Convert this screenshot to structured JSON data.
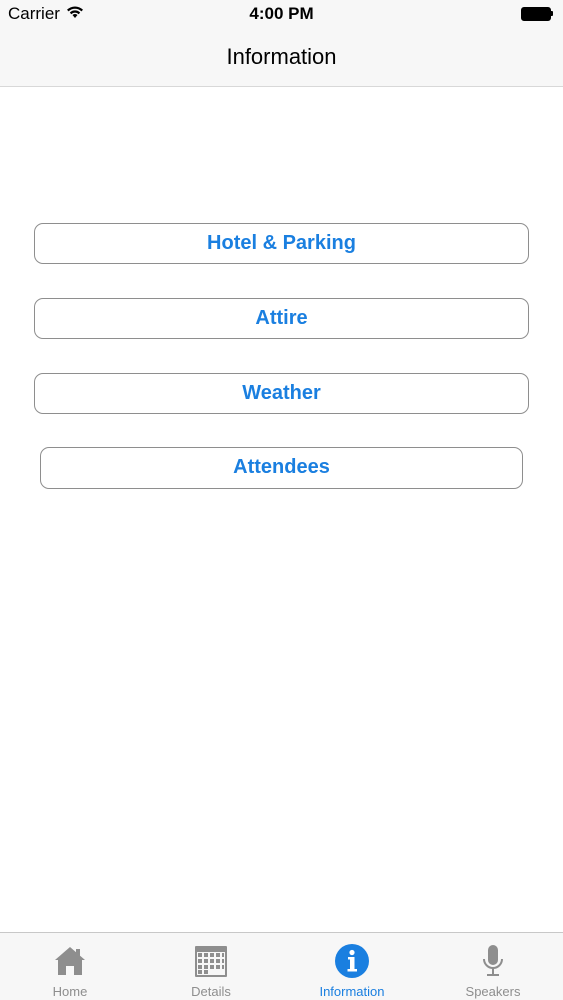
{
  "status_bar": {
    "carrier": "Carrier",
    "time": "4:00 PM"
  },
  "nav": {
    "title": "Information"
  },
  "buttons": {
    "hotel": "Hotel & Parking",
    "attire": "Attire",
    "weather": "Weather",
    "attendees": "Attendees"
  },
  "tabs": [
    {
      "label": "Home",
      "icon": "home-icon",
      "active": false
    },
    {
      "label": "Details",
      "icon": "calendar-icon",
      "active": false
    },
    {
      "label": "Information",
      "icon": "info-icon",
      "active": true
    },
    {
      "label": "Speakers",
      "icon": "microphone-icon",
      "active": false
    }
  ],
  "colors": {
    "accent": "#1a7fe0",
    "inactive": "#8e8e8e",
    "bar_background": "#f7f7f7"
  }
}
